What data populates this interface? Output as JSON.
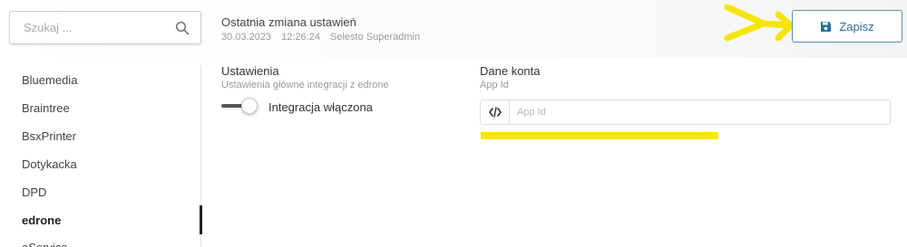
{
  "search": {
    "placeholder": "Szukaj ...",
    "value": "",
    "icon": "search-icon"
  },
  "last_change": {
    "title": "Ostatnia zmiana ustawień",
    "date": "30.03.2023",
    "time": "12:26:24",
    "user": "Selesto Superadmin"
  },
  "toolbar": {
    "save_label": "Zapisz",
    "save_icon": "floppy-disk-icon"
  },
  "annotation": {
    "color": "#f5e50a"
  },
  "sidebar": {
    "items": [
      {
        "label": "Bluemedia"
      },
      {
        "label": "Braintree"
      },
      {
        "label": "BsxPrinter"
      },
      {
        "label": "Dotykacka"
      },
      {
        "label": "DPD"
      },
      {
        "label": "edrone",
        "active": true
      },
      {
        "label": "eService"
      }
    ]
  },
  "settings": {
    "title": "Ustawienia",
    "subtitle": "Ustawienia główne integracji z edrone",
    "toggle_label": "Integracja włączona",
    "toggle_on": true
  },
  "account": {
    "title": "Dane konta",
    "subtitle": "App Id",
    "app_id_placeholder": "App Id",
    "app_id_value": "",
    "app_id_icon": "code-icon"
  },
  "colors": {
    "accent": "#2d6d99",
    "button_border": "#5b8fb5"
  }
}
